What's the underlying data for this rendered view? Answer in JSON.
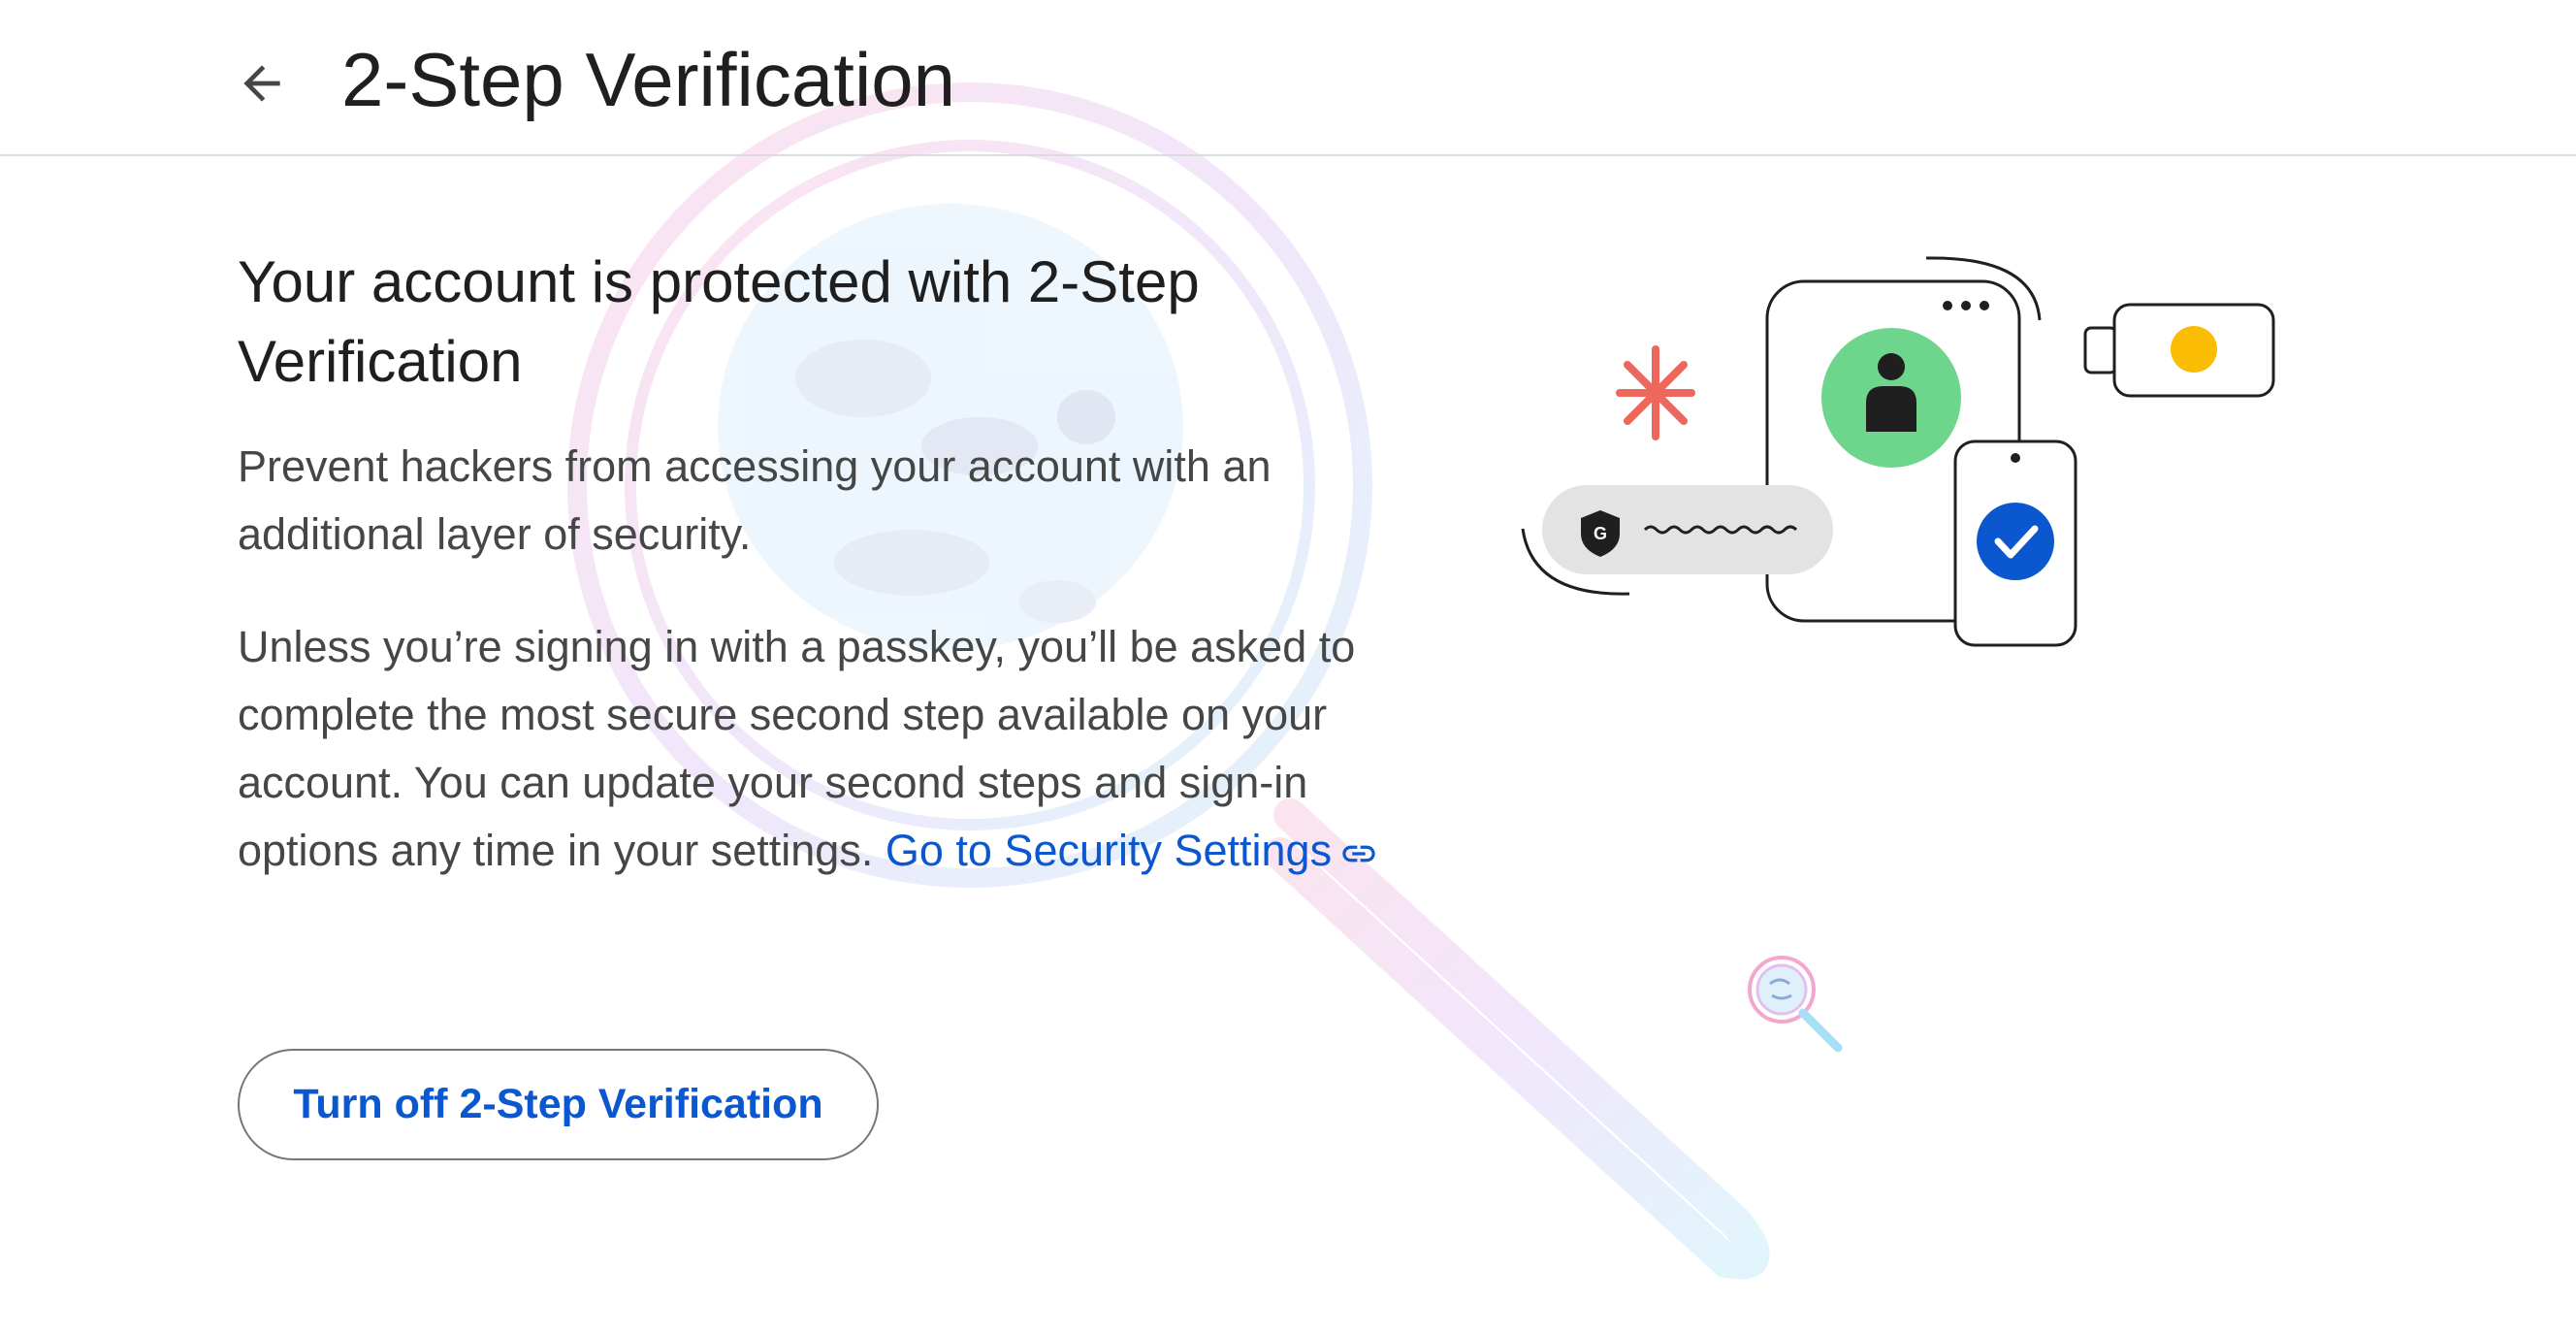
{
  "header": {
    "title": "2-Step Verification",
    "back_icon": "arrow-back-icon"
  },
  "main": {
    "heading": "Your account is protected with 2-Step Verification",
    "paragraph1": "Prevent hackers from accessing your account with an additional layer of security.",
    "paragraph2": "Unless you’re signing in with a passkey, you’ll be asked to complete the most secure second step available on your account. You can update your second steps and sign-in options any time in your settings.",
    "security_link": "Go to Security Settings",
    "link_icon": "link-icon",
    "turn_off_button": "Turn off 2-Step Verification"
  },
  "colors": {
    "link": "#0b57d0",
    "body_text": "#444746",
    "heading_text": "#1f1f1f",
    "button_border": "#747775",
    "divider": "#dadce0",
    "illustration_green": "#6dd58c",
    "illustration_blue": "#0b57d0",
    "illustration_red": "#ee675c",
    "illustration_yellow": "#fbbc04"
  }
}
